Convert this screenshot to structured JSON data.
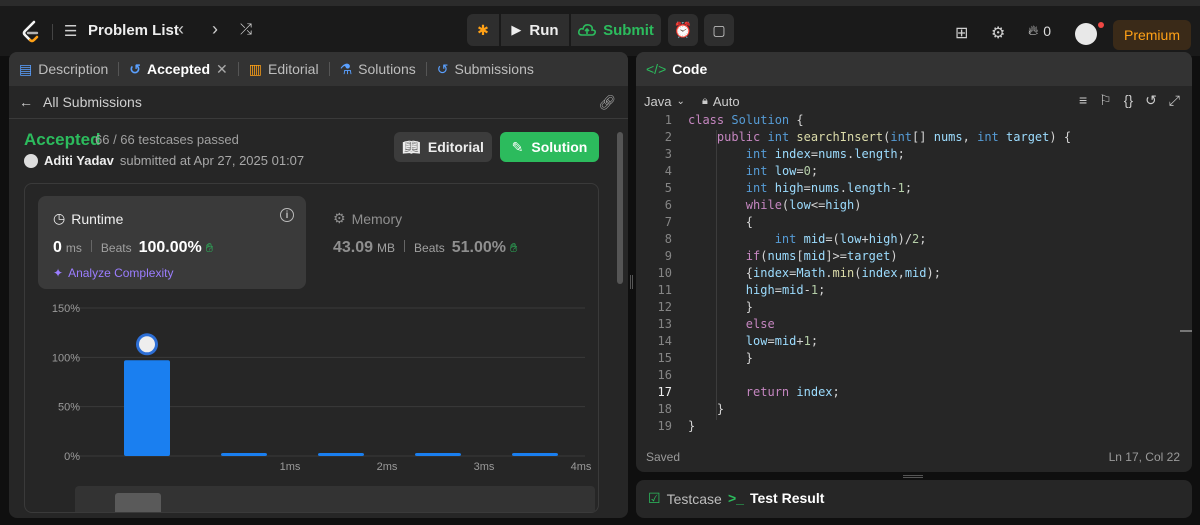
{
  "topbar": {
    "problem_list": "Problem List",
    "run": "Run",
    "submit": "Submit",
    "streak": "0",
    "premium": "Premium"
  },
  "left_tabs": [
    "Description",
    "Accepted",
    "Editorial",
    "Solutions",
    "Submissions"
  ],
  "submission": {
    "back_label": "All Submissions",
    "status": "Accepted",
    "testcases": "66 / 66 testcases passed",
    "user": "Aditi Yadav",
    "submitted_at": "submitted at Apr 27, 2025 01:07",
    "editorial_btn": "Editorial",
    "solution_btn": "Solution"
  },
  "runtime": {
    "title": "Runtime",
    "value": "0",
    "unit": "ms",
    "beats_label": "Beats",
    "beats": "100.00%",
    "analyze": "Analyze Complexity"
  },
  "memory": {
    "title": "Memory",
    "value": "43.09",
    "unit": "MB",
    "beats_label": "Beats",
    "beats": "51.00%"
  },
  "chart_data": {
    "type": "bar",
    "categories": [
      "",
      "1ms",
      "2ms",
      "3ms",
      "4ms"
    ],
    "values": [
      97,
      3,
      3,
      3,
      3
    ],
    "yticks": [
      "150%",
      "100%",
      "50%",
      "0%"
    ],
    "ylim": [
      0,
      150
    ],
    "grid": true,
    "highlight_index": 0,
    "bar_color": "#1a7ff0"
  },
  "code": {
    "tab": "Code",
    "language": "Java",
    "mode": "Auto",
    "saved": "Saved",
    "cursor": "Ln 17, Col 22",
    "current_line": 17,
    "lines": [
      "class Solution {",
      "    public int searchInsert(int[] nums, int target) {",
      "        int index=nums.length;",
      "        int low=0;",
      "        int high=nums.length-1;",
      "        while(low<=high)",
      "        {",
      "            int mid=(low+high)/2;",
      "        if(nums[mid]>=target)",
      "        {index=Math.min(index,mid);",
      "        high=mid-1;",
      "        }",
      "        else",
      "        low=mid+1;",
      "        }",
      "",
      "        return index;",
      "    }",
      "}"
    ]
  },
  "bottom_tabs": [
    "Testcase",
    "Test Result"
  ],
  "colors": {
    "accent_green": "#2cbb5d",
    "premium": "#ffa116",
    "bar": "#1a7ff0"
  }
}
